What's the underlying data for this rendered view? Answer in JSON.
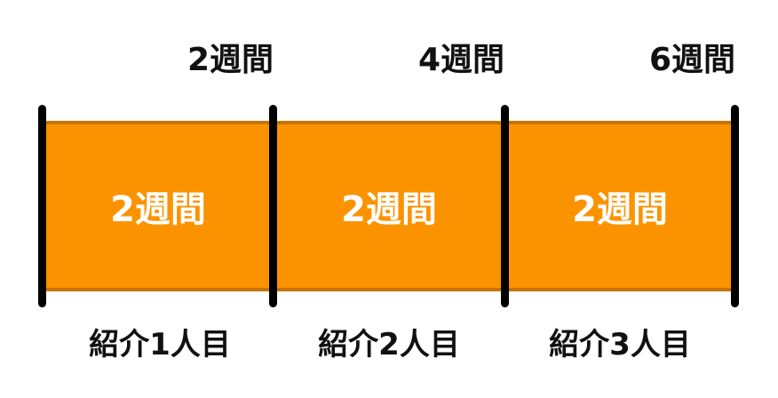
{
  "milestones": [
    {
      "label": "2週間"
    },
    {
      "label": "4週間"
    },
    {
      "label": "6週間"
    }
  ],
  "segments": [
    {
      "label": "2週間",
      "color": "#fb9300"
    },
    {
      "label": "2週間",
      "color": "#fb9300"
    },
    {
      "label": "2週間",
      "color": "#fb9300"
    }
  ],
  "introductions": [
    {
      "label": "紹介1人目"
    },
    {
      "label": "紹介2人目"
    },
    {
      "label": "紹介3人目"
    }
  ],
  "colors": {
    "segment_fill": "#fb9300",
    "divider": "#000000",
    "text_dark": "#111111",
    "text_light": "#ffffff"
  }
}
